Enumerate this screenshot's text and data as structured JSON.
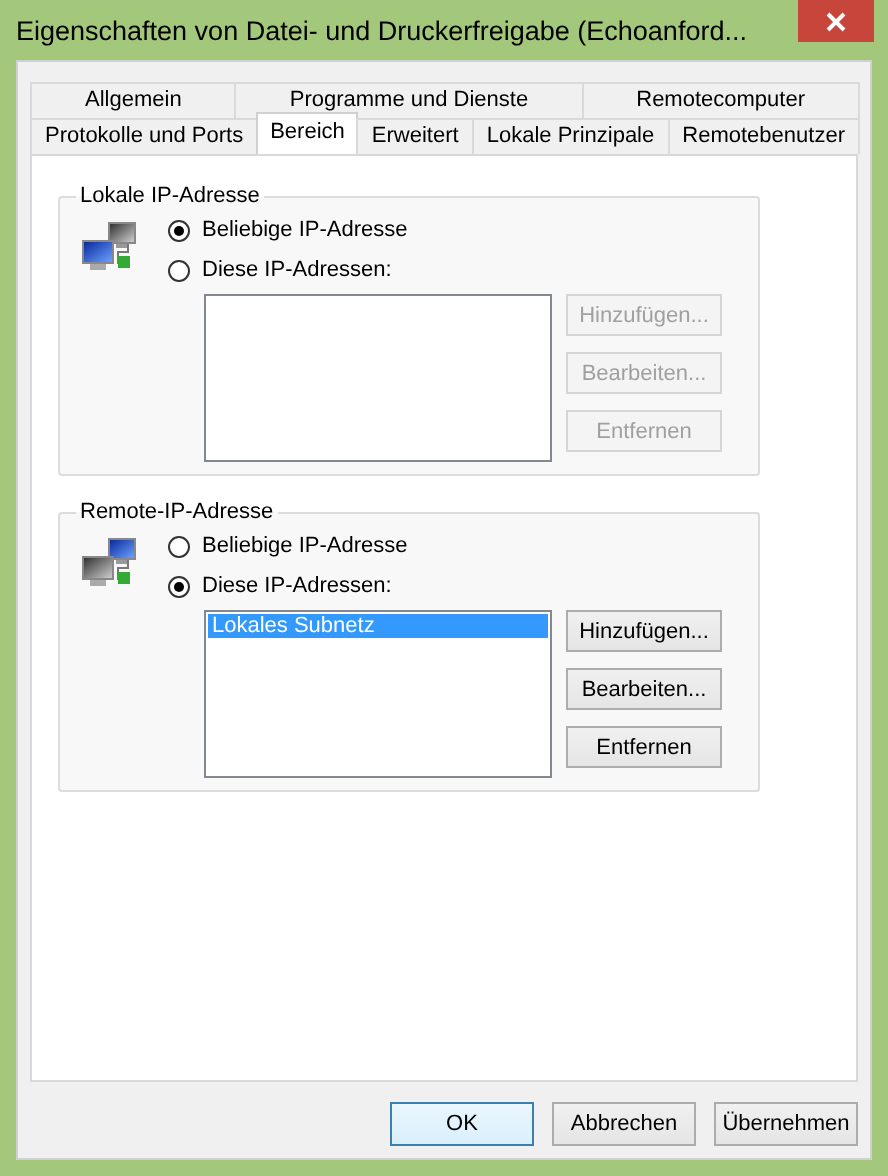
{
  "window": {
    "title": "Eigenschaften von Datei- und Druckerfreigabe (Echoanford..."
  },
  "tab_rows": [
    [
      {
        "label": "Allgemein",
        "selected": false
      },
      {
        "label": "Programme und Dienste",
        "selected": false
      },
      {
        "label": "Remotecomputer",
        "selected": false
      }
    ],
    [
      {
        "label": "Protokolle und Ports",
        "selected": false
      },
      {
        "label": "Bereich",
        "selected": true
      },
      {
        "label": "Erweitert",
        "selected": false
      },
      {
        "label": "Lokale Prinzipale",
        "selected": false
      },
      {
        "label": "Remotebenutzer",
        "selected": false
      }
    ]
  ],
  "groups": [
    {
      "title": "Lokale IP-Adresse",
      "kind": "local",
      "options": [
        {
          "label": "Beliebige IP-Adresse",
          "selected": true
        },
        {
          "label": "Diese IP-Adressen:",
          "selected": false
        }
      ],
      "buttons": [
        {
          "label": "Hinzufügen...",
          "disabled": true
        },
        {
          "label": "Bearbeiten...",
          "disabled": true
        },
        {
          "label": "Entfernen",
          "disabled": true
        }
      ]
    },
    {
      "title": "Remote-IP-Adresse",
      "kind": "remote",
      "options": [
        {
          "label": "Beliebige IP-Adresse",
          "selected": false
        },
        {
          "label": "Diese IP-Adressen:",
          "selected": true
        }
      ],
      "list": [
        {
          "text": "Lokales Subnetz",
          "selected": true
        }
      ],
      "buttons": [
        {
          "label": "Hinzufügen...",
          "disabled": false
        },
        {
          "label": "Bearbeiten...",
          "disabled": false
        },
        {
          "label": "Entfernen",
          "disabled": false
        }
      ]
    }
  ],
  "buttons": [
    {
      "label": "OK",
      "default": true
    },
    {
      "label": "Abbrechen",
      "default": false
    },
    {
      "label": "Übernehmen",
      "default": false
    }
  ]
}
